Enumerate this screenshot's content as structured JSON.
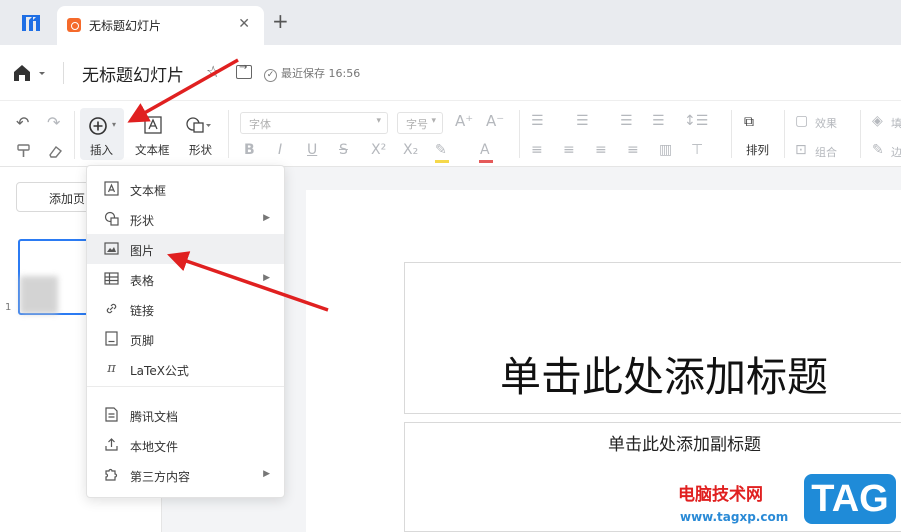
{
  "tab": {
    "title": "无标题幻灯片",
    "close": "✕",
    "add": "+"
  },
  "titlebar": {
    "doc_title": "无标题幻灯片",
    "save_status": "最近保存 16:56"
  },
  "toolbar": {
    "insert_label": "插入",
    "textbox_label": "文本框",
    "shape_label": "形状",
    "font_placeholder": "字体",
    "size_placeholder": "字号",
    "arrange_label": "排列",
    "effect_label": "效果",
    "group_label": "组合",
    "fill_label": "填",
    "border_label": "边"
  },
  "left_panel": {
    "add_page": "添加页",
    "slide_number": "1"
  },
  "slide": {
    "title_placeholder": "单击此处添加标题",
    "subtitle_placeholder": "单击此处添加副标题"
  },
  "insert_menu": {
    "items": [
      {
        "label": "文本框",
        "icon": "textbox-icon"
      },
      {
        "label": "形状",
        "icon": "shape-icon",
        "submenu": true
      },
      {
        "label": "图片",
        "icon": "image-icon"
      },
      {
        "label": "表格",
        "icon": "table-icon",
        "submenu": true
      },
      {
        "label": "链接",
        "icon": "link-icon"
      },
      {
        "label": "页脚",
        "icon": "footer-icon"
      },
      {
        "label": "LaTeX公式",
        "icon": "pi-icon"
      },
      {
        "label": "腾讯文档",
        "icon": "tencent-doc-icon"
      },
      {
        "label": "本地文件",
        "icon": "upload-icon"
      },
      {
        "label": "第三方内容",
        "icon": "puzzle-icon",
        "submenu": true
      }
    ],
    "hovered": "图片"
  },
  "watermark": {
    "site_name": "电脑技术网",
    "url": "www.tagxp.com",
    "tag": "TAG"
  },
  "colors": {
    "accent": "#2b7bf3",
    "annotation_arrow": "#e02020",
    "tab_icon": "#f56a2b"
  }
}
